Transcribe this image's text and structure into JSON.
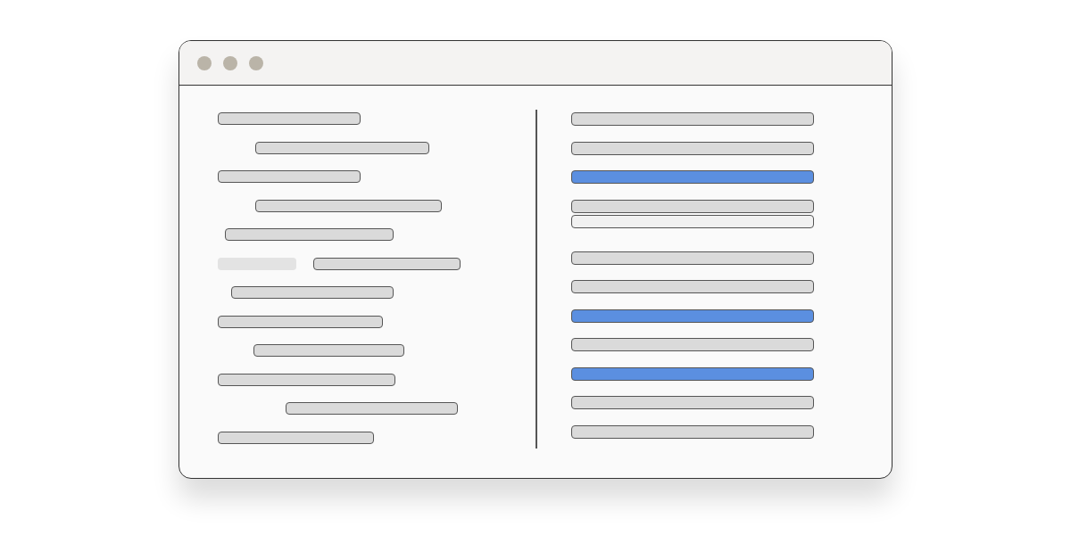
{
  "window": {
    "controls": [
      {
        "kind": "dot"
      },
      {
        "kind": "dot"
      },
      {
        "kind": "dot"
      }
    ]
  },
  "left_lines": [
    {
      "kind": "line"
    },
    {
      "kind": "line"
    },
    {
      "kind": "line"
    },
    {
      "kind": "line"
    },
    {
      "kind": "line"
    },
    {
      "kind": "pair"
    },
    {
      "kind": "line"
    },
    {
      "kind": "line"
    },
    {
      "kind": "line"
    },
    {
      "kind": "line"
    },
    {
      "kind": "line"
    },
    {
      "kind": "line"
    }
  ],
  "right_list": [
    {
      "kind": "bar",
      "selected": false
    },
    {
      "kind": "bar",
      "selected": false
    },
    {
      "kind": "bar",
      "selected": true
    },
    {
      "kind": "bar",
      "selected": false
    },
    {
      "kind": "ghost",
      "selected": false
    },
    {
      "kind": "bar",
      "selected": false
    },
    {
      "kind": "bar",
      "selected": false
    },
    {
      "kind": "bar",
      "selected": true
    },
    {
      "kind": "bar",
      "selected": false
    },
    {
      "kind": "bar",
      "selected": true
    },
    {
      "kind": "bar",
      "selected": false
    },
    {
      "kind": "bar",
      "selected": false
    }
  ]
}
